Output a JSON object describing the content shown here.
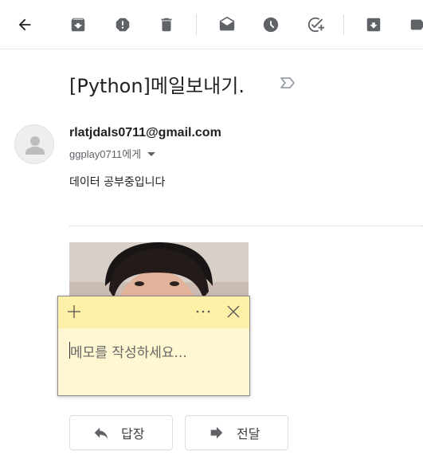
{
  "toolbar": {
    "icons": [
      "back-arrow-icon",
      "archive-icon",
      "report-spam-icon",
      "delete-icon",
      "mark-unread-icon",
      "snooze-icon",
      "add-task-icon",
      "move-to-icon",
      "label-icon"
    ]
  },
  "email": {
    "subject": "[Python]메일보내기.",
    "sender": "rlatjdals0711@gmail.com",
    "recipient": "ggplay0711에게",
    "body": "데이터 공부중입니다"
  },
  "sticky_note": {
    "placeholder": "메모를 작성하세요..."
  },
  "actions": {
    "reply_label": "답장",
    "forward_label": "전달"
  },
  "colors": {
    "sticky_bg": "#fff7d1",
    "sticky_bar": "#fff0a8",
    "icon_gray": "#5f6368"
  }
}
